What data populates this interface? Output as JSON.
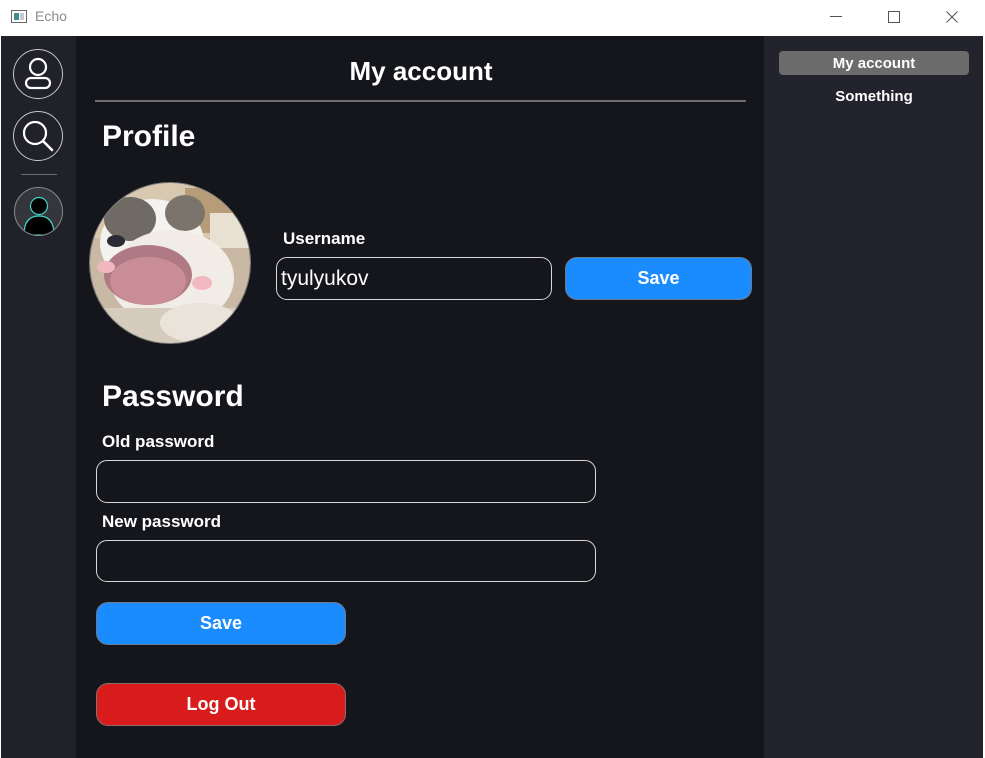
{
  "window": {
    "title": "Echo"
  },
  "sidebar": {
    "items": [
      {
        "icon": "profile-icon"
      },
      {
        "icon": "search-icon"
      }
    ],
    "user_avatar": {
      "icon": "user-silhouette-icon",
      "accent": "#3fd6c8"
    }
  },
  "main": {
    "page_title": "My account",
    "profile": {
      "heading": "Profile",
      "username_label": "Username",
      "username_value": "tyulyukov",
      "save_label": "Save"
    },
    "password": {
      "heading": "Password",
      "old_label": "Old password",
      "old_value": "",
      "new_label": "New password",
      "new_value": "",
      "save_label": "Save"
    },
    "logout_label": "Log Out"
  },
  "right_nav": {
    "items": [
      {
        "label": "My account",
        "active": true
      },
      {
        "label": "Something",
        "active": false
      }
    ]
  },
  "colors": {
    "background": "#15161b",
    "sidebar": "#202129",
    "right_panel": "#22232d",
    "accent_blue": "#1a8cff",
    "danger_red": "#d81c1c"
  }
}
